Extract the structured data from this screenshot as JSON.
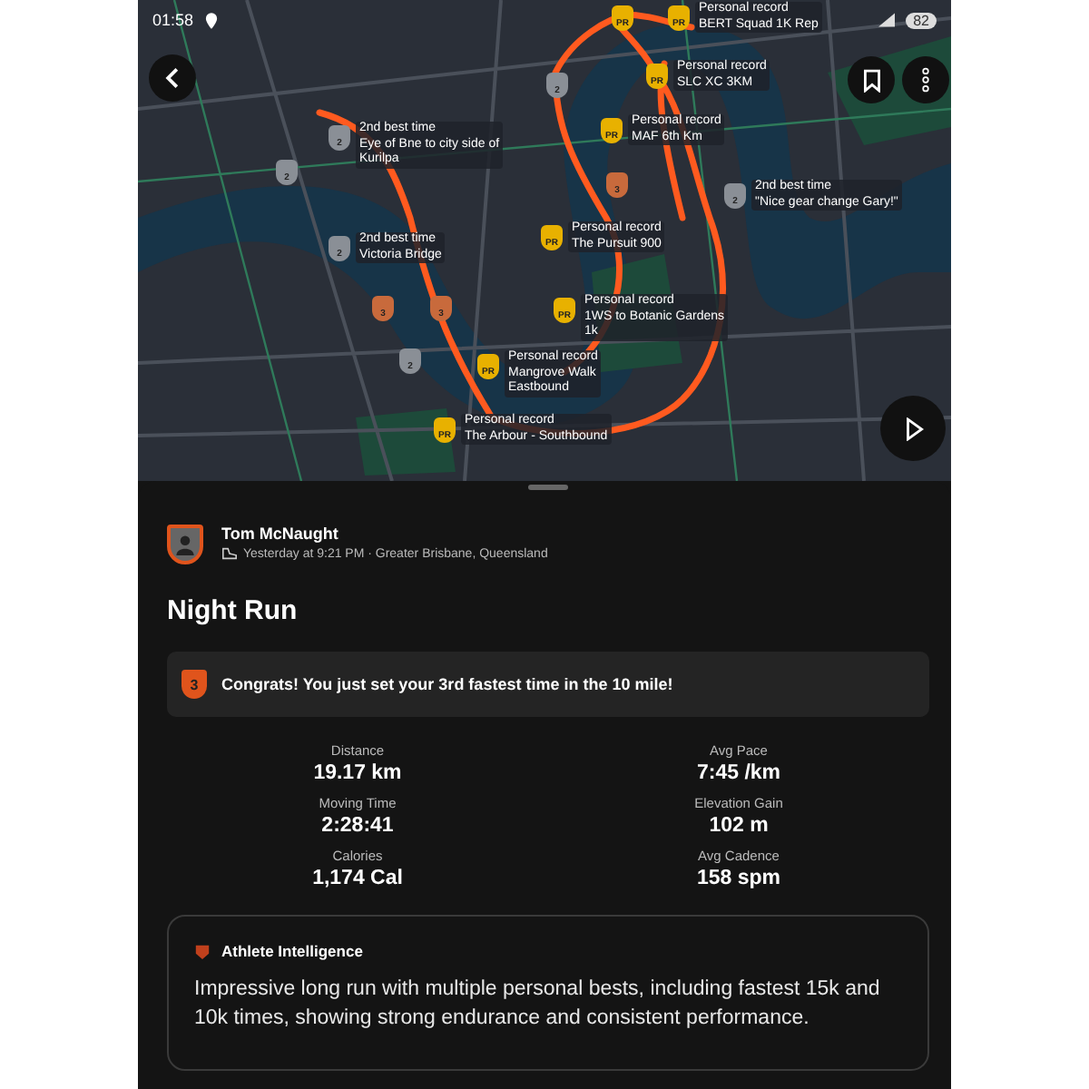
{
  "status_bar": {
    "time": "01:58",
    "battery": "82"
  },
  "map": {
    "markers": [
      {
        "kind": "pr",
        "badge": "PR"
      },
      {
        "kind": "pr",
        "badge": "PR",
        "lines": [
          "Personal record",
          "BERT Squad 1K Rep"
        ]
      },
      {
        "kind": "pr",
        "badge": "PR",
        "lines": [
          "Personal record",
          "SLC XC 3KM"
        ]
      },
      {
        "kind": "pr",
        "badge": "PR",
        "lines": [
          "Personal record",
          "MAF 6th Km"
        ]
      },
      {
        "kind": "third",
        "badge": "3"
      },
      {
        "kind": "second",
        "badge": "2",
        "lines": [
          "2nd best time",
          "\"Nice gear change Gary!\""
        ]
      },
      {
        "kind": "second",
        "badge": "2"
      },
      {
        "kind": "second",
        "badge": "2",
        "lines": [
          "2nd best time",
          "Eye of Bne to city side of",
          "Kurilpa"
        ]
      },
      {
        "kind": "second",
        "badge": "2"
      },
      {
        "kind": "pr",
        "badge": "PR",
        "lines": [
          "Personal record",
          "The Pursuit 900"
        ]
      },
      {
        "kind": "second",
        "badge": "2",
        "lines": [
          "2nd best time",
          "Victoria Bridge"
        ]
      },
      {
        "kind": "third",
        "badge": "3"
      },
      {
        "kind": "third",
        "badge": "3"
      },
      {
        "kind": "pr",
        "badge": "PR",
        "lines": [
          "Personal record",
          "1WS to Botanic Gardens",
          "1k"
        ]
      },
      {
        "kind": "second",
        "badge": "2"
      },
      {
        "kind": "pr",
        "badge": "PR",
        "lines": [
          "Personal record",
          "Mangrove Walk",
          "Eastbound"
        ]
      },
      {
        "kind": "pr",
        "badge": "PR",
        "lines": [
          "Personal record",
          "The Arbour - Southbound"
        ]
      }
    ]
  },
  "athlete": {
    "name": "Tom McNaught",
    "meta": "Yesterday at 9:21 PM · Greater Brisbane, Queensland"
  },
  "title": "Night Run",
  "achievement": {
    "badge": "3",
    "text": "Congrats! You just set your 3rd fastest time in the 10 mile!"
  },
  "stats": [
    {
      "label": "Distance",
      "value": "19.17 km"
    },
    {
      "label": "Avg Pace",
      "value": "7:45 /km"
    },
    {
      "label": "Moving Time",
      "value": "2:28:41"
    },
    {
      "label": "Elevation Gain",
      "value": "102 m"
    },
    {
      "label": "Calories",
      "value": "1,174 Cal"
    },
    {
      "label": "Avg Cadence",
      "value": "158 spm"
    }
  ],
  "insight": {
    "title": "Athlete Intelligence",
    "text": "Impressive long run with multiple personal bests, including fastest 15k and 10k times, showing strong endurance and consistent performance."
  }
}
